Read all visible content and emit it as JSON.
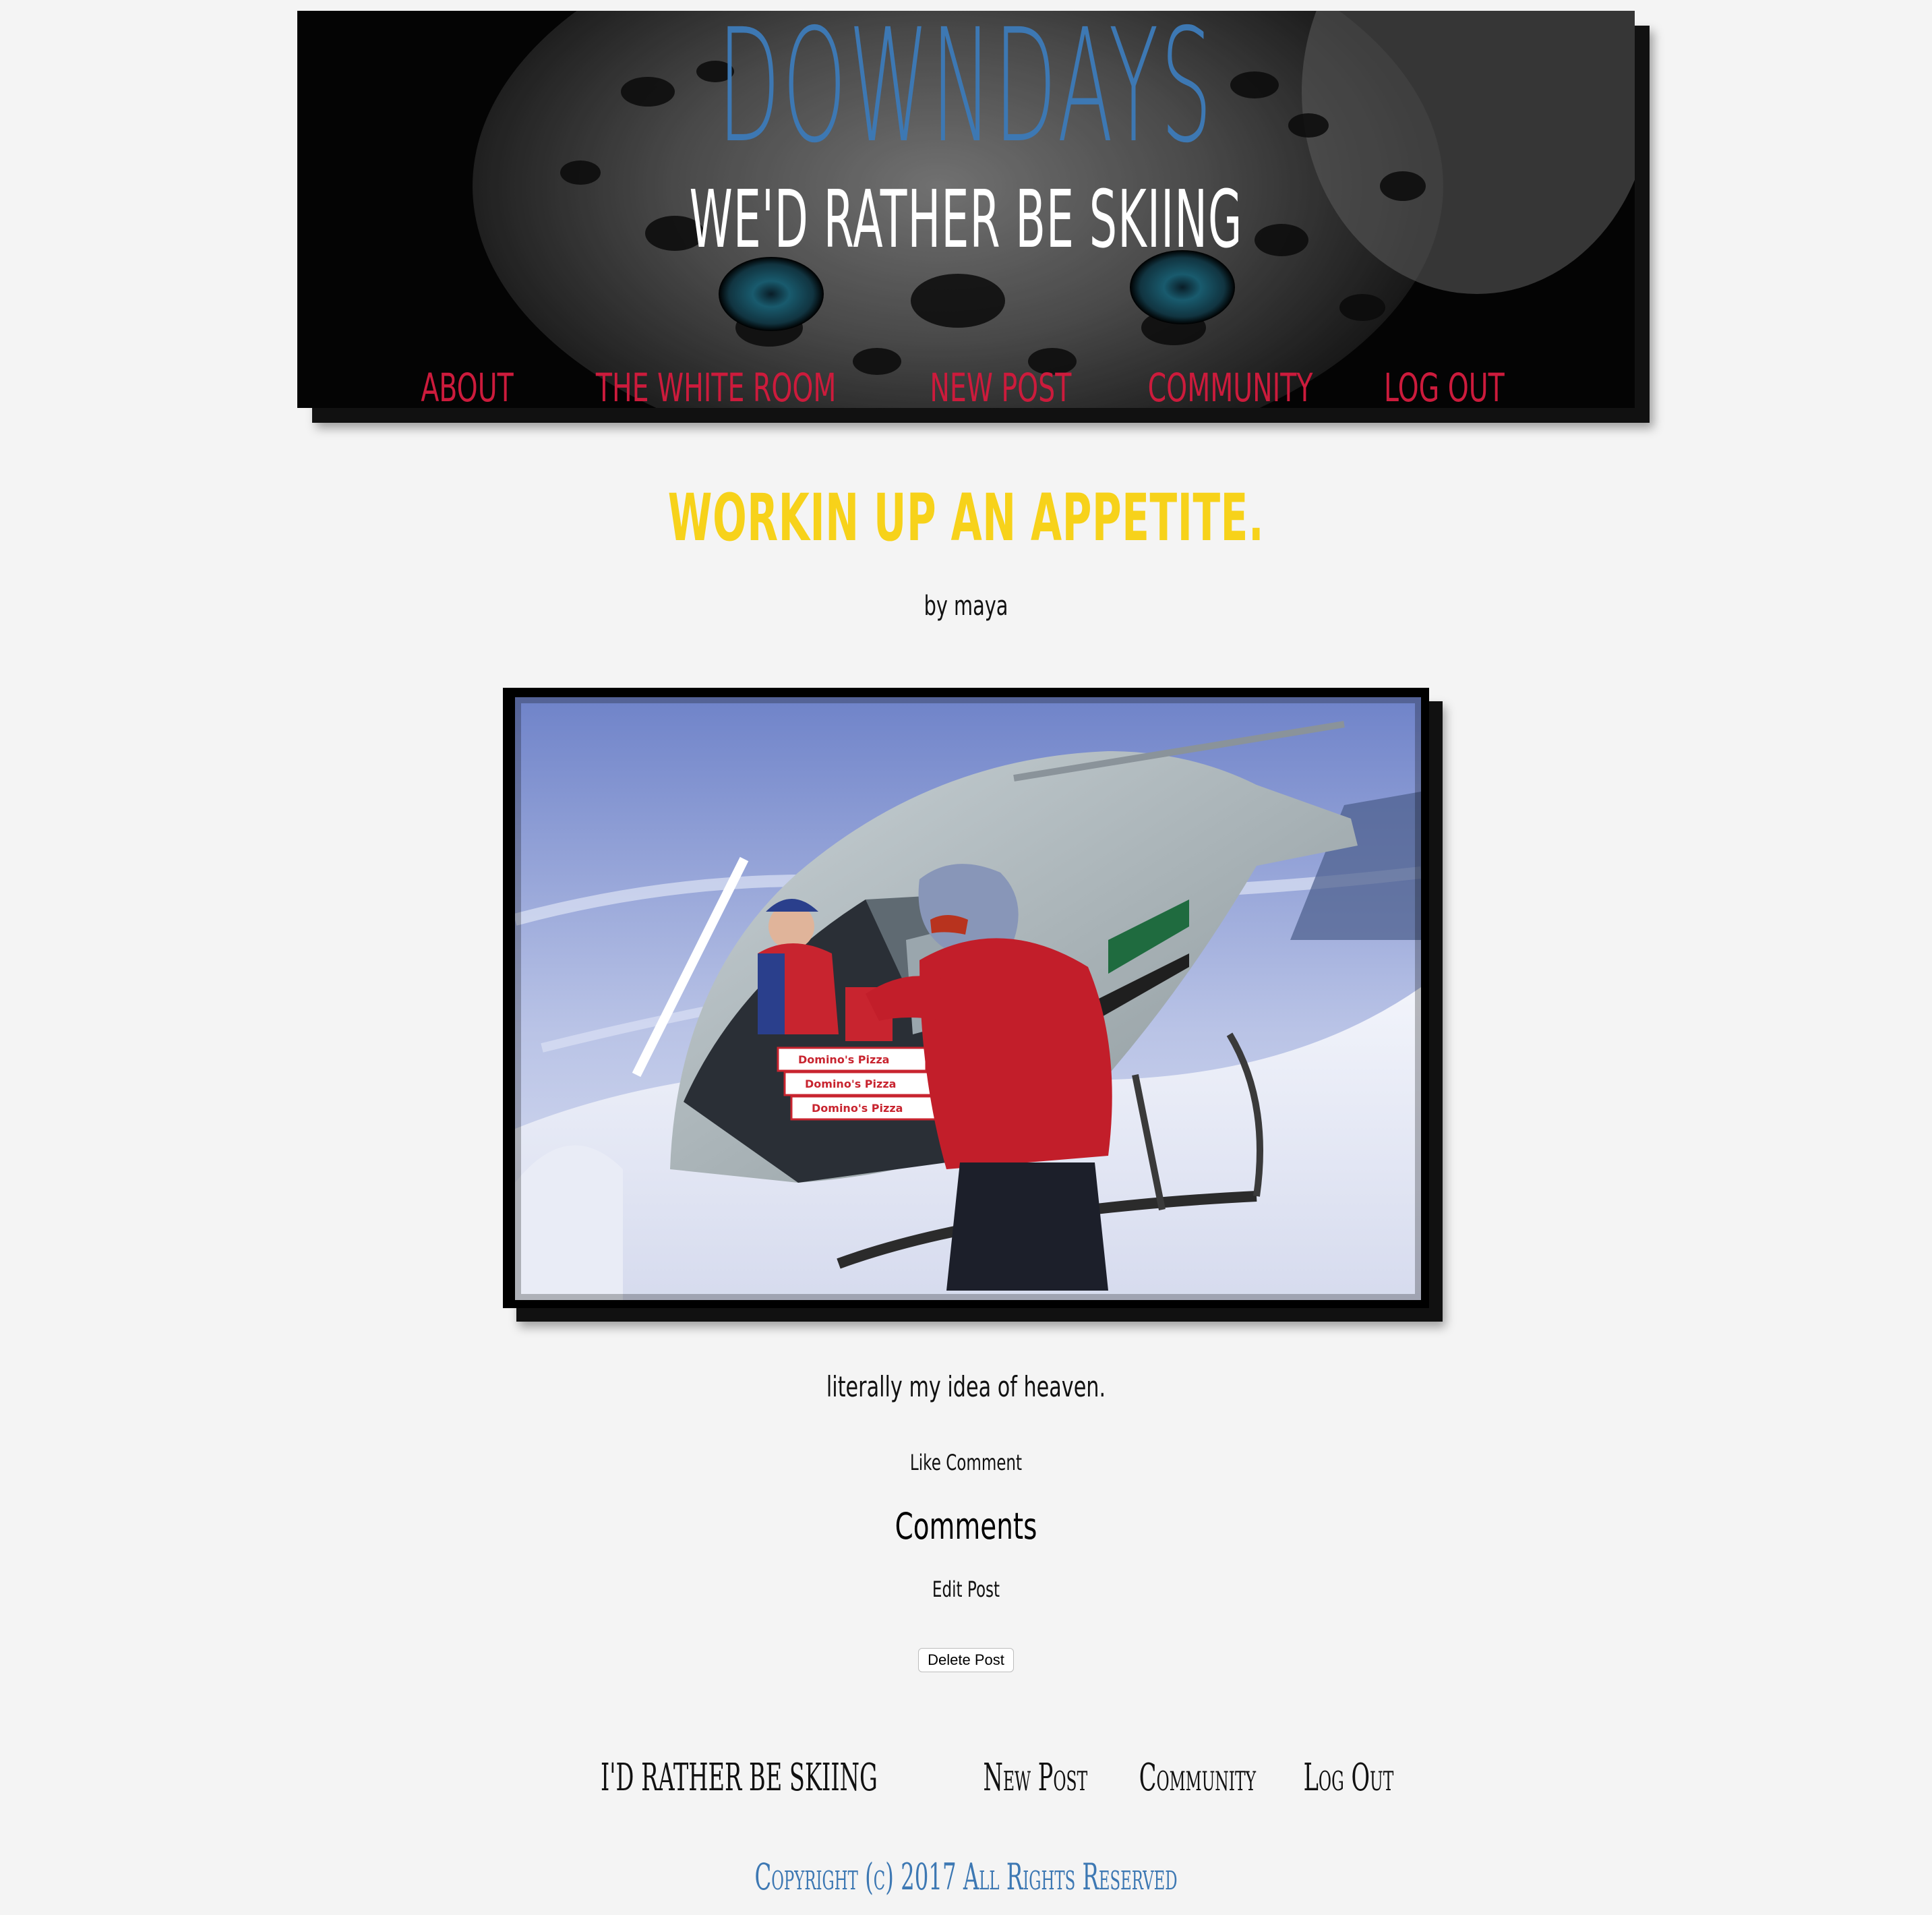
{
  "header": {
    "site_title": "DOWNDAYS",
    "tagline": "WE'D RATHER BE SKIING",
    "nav": [
      {
        "label": "ABOUT"
      },
      {
        "label": "THE WHITE ROOM"
      },
      {
        "label": "NEW POST"
      },
      {
        "label": "COMMUNITY"
      },
      {
        "label": "LOG OUT"
      }
    ]
  },
  "post": {
    "title": "WORKIN UP AN APPETITE.",
    "byline": "by maya",
    "photo_alt": "Skier receiving pizza delivery from a helicopter on a snowy peak",
    "pizza_box_label": "Domino's Pizza",
    "body": "literally my idea of heaven.",
    "like_label": "Like",
    "comment_label": "Comment",
    "comments_heading": "Comments",
    "edit_label": "Edit Post",
    "delete_label": "Delete Post"
  },
  "footer": {
    "nav": [
      {
        "label": "I'D RATHER BE SKIING"
      },
      {
        "label": "New Post"
      },
      {
        "label": "Community"
      },
      {
        "label": "Log Out"
      }
    ],
    "copyright": "Copyright (c) 2017 All Rights Reserved"
  },
  "colors": {
    "background": "#f4f4f4",
    "title_blue": "#3d78b3",
    "nav_red": "#cc1b3c",
    "post_title_yellow": "#f7d21a"
  }
}
